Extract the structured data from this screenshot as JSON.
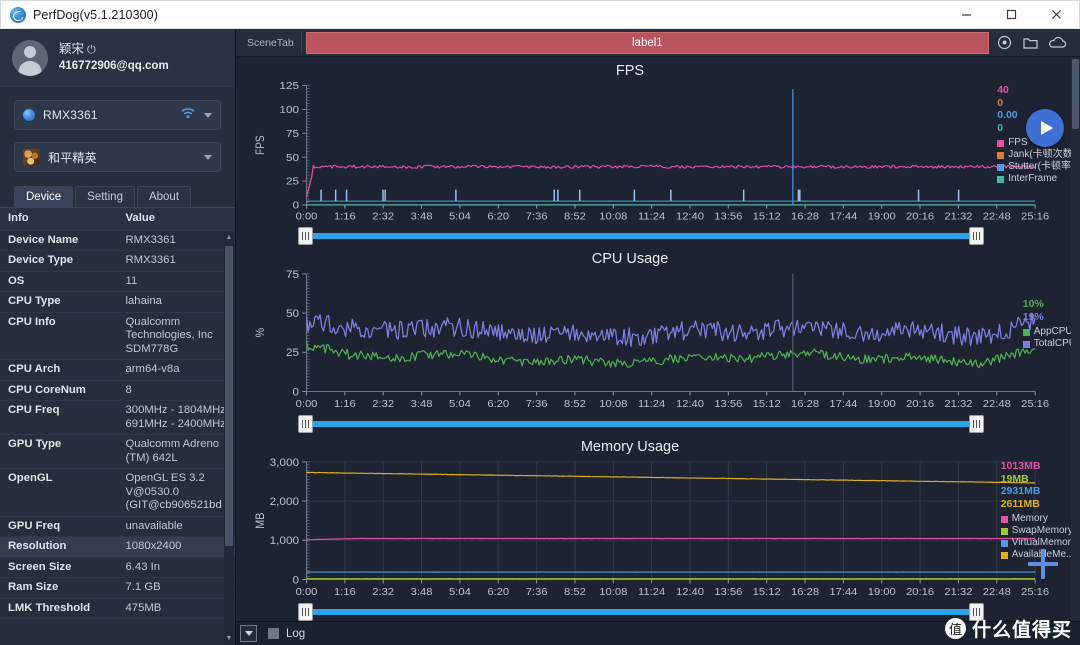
{
  "window": {
    "title": "PerfDog(v5.1.210300)",
    "minimize_label": "Minimize",
    "maximize_label": "Maximize",
    "close_label": "Close"
  },
  "sidebar": {
    "user": {
      "name": "颖宋",
      "power_glyph": "⏻",
      "email": "416772906@qq.com"
    },
    "device_select": {
      "value": "RMX3361"
    },
    "app_select": {
      "value": "和平精英"
    },
    "tabs": [
      {
        "label": "Device",
        "active": true
      },
      {
        "label": "Setting",
        "active": false
      },
      {
        "label": "About",
        "active": false
      }
    ],
    "table": {
      "headers": [
        "Info",
        "Value"
      ],
      "rows": [
        {
          "key": "Device Name",
          "value": "RMX3361",
          "highlight": false
        },
        {
          "key": "Device Type",
          "value": "RMX3361",
          "highlight": false
        },
        {
          "key": "OS",
          "value": "11",
          "highlight": false
        },
        {
          "key": "CPU Type",
          "value": "lahaina",
          "highlight": false
        },
        {
          "key": "CPU Info",
          "value": "Qualcomm Technologies, Inc SDM778G",
          "highlight": false
        },
        {
          "key": "CPU Arch",
          "value": "arm64-v8a",
          "highlight": false
        },
        {
          "key": "CPU CoreNum",
          "value": "8",
          "highlight": false
        },
        {
          "key": "CPU Freq",
          "value": "300MHz - 1804MHz 691MHz - 2400MHz",
          "highlight": false
        },
        {
          "key": "GPU Type",
          "value": "Qualcomm Adreno (TM) 642L",
          "highlight": false
        },
        {
          "key": "OpenGL",
          "value": "OpenGL ES 3.2 V@0530.0 (GIT@cb906521bd",
          "highlight": false
        },
        {
          "key": "GPU Freq",
          "value": "unavailable",
          "highlight": false
        },
        {
          "key": "Resolution",
          "value": "1080x2400",
          "highlight": true
        },
        {
          "key": "Screen Size",
          "value": "6.43 In",
          "highlight": false
        },
        {
          "key": "Ram Size",
          "value": "7.1 GB",
          "highlight": false
        },
        {
          "key": "LMK Threshold",
          "value": "475MB",
          "highlight": false
        }
      ]
    }
  },
  "scenebar": {
    "scene_tab_label": "SceneTab",
    "label_text": "label1",
    "icons": [
      "location-icon",
      "folder-icon",
      "cloud-icon"
    ]
  },
  "controls": {
    "play_label": "Play",
    "add_label": "Add",
    "log_label": "Log",
    "expand_label": "Expand"
  },
  "watermark": {
    "badge": "值",
    "text": "什么值得买"
  },
  "chart_data": [
    {
      "type": "line",
      "title": "FPS",
      "ylabel": "FPS",
      "xlabel": "",
      "ylim": [
        0,
        125
      ],
      "yticks": [
        0,
        25,
        50,
        75,
        100,
        125
      ],
      "ytick_labels": [
        "0",
        "25",
        "50",
        "75",
        "100",
        "125"
      ],
      "xtick_labels": [
        "0:00",
        "1:16",
        "2:32",
        "3:48",
        "5:04",
        "6:20",
        "7:36",
        "8:52",
        "10:08",
        "11:24",
        "12:40",
        "13:56",
        "15:12",
        "16:28",
        "17:44",
        "19:00",
        "20:16",
        "21:32",
        "22:48",
        "25:16"
      ],
      "grid": false,
      "legend_position": "right",
      "readouts": [
        {
          "value": "40",
          "color": "#e34ea8"
        },
        {
          "value": "0",
          "color": "#e07830"
        },
        {
          "value": "0.00",
          "color": "#4f9ae8"
        },
        {
          "value": "0",
          "color": "#3fb8a8"
        }
      ],
      "series": [
        {
          "name": "FPS",
          "color": "#e34ea8",
          "mean": 40,
          "noise": 1.6
        },
        {
          "name": "Jank(卡顿次数)",
          "color": "#e07830",
          "mean": 0,
          "noise": 0
        },
        {
          "name": "Stutter(卡顿率)",
          "color": "#4f9ae8",
          "mean": 0,
          "noise": 0
        },
        {
          "name": "InterFrame",
          "color": "#3fb8a8",
          "mean": 0,
          "noise": 0
        }
      ]
    },
    {
      "type": "line",
      "title": "CPU Usage",
      "ylabel": "%",
      "xlabel": "",
      "ylim": [
        0,
        75
      ],
      "yticks": [
        0,
        25,
        50,
        75
      ],
      "ytick_labels": [
        "0",
        "25",
        "50",
        "75"
      ],
      "xtick_labels": [
        "0:00",
        "1:16",
        "2:32",
        "3:48",
        "5:04",
        "6:20",
        "7:36",
        "8:52",
        "10:08",
        "11:24",
        "12:40",
        "13:56",
        "15:12",
        "16:28",
        "17:44",
        "19:00",
        "20:16",
        "21:32",
        "22:48",
        "25:16"
      ],
      "grid": false,
      "legend_position": "right",
      "readouts": [
        {
          "value": "10%",
          "color": "#4caf50"
        },
        {
          "value": "19%",
          "color": "#7b7fe0"
        }
      ],
      "series": [
        {
          "name": "AppCPU",
          "color": "#4caf50",
          "mean": 21,
          "noise": 3
        },
        {
          "name": "TotalCPU",
          "color": "#7b7fe0",
          "mean": 38,
          "noise": 6
        }
      ]
    },
    {
      "type": "line",
      "title": "Memory Usage",
      "ylabel": "MB",
      "xlabel": "",
      "ylim": [
        0,
        3000
      ],
      "yticks": [
        0,
        1000,
        2000,
        3000
      ],
      "ytick_labels": [
        "0",
        "1,000",
        "2,000",
        "3,000"
      ],
      "xtick_labels": [
        "0:00",
        "1:16",
        "2:32",
        "3:48",
        "5:04",
        "6:20",
        "7:36",
        "8:52",
        "10:08",
        "11:24",
        "12:40",
        "13:56",
        "15:12",
        "16:28",
        "17:44",
        "19:00",
        "20:16",
        "21:32",
        "22:48",
        "25:16"
      ],
      "grid": true,
      "legend_position": "right",
      "readouts": [
        {
          "value": "1013MB",
          "color": "#e34ea8"
        },
        {
          "value": "19MB",
          "color": "#9ccc3a"
        },
        {
          "value": "2931MB",
          "color": "#4f9ae8"
        },
        {
          "value": "2611MB",
          "color": "#e0b020"
        }
      ],
      "series": [
        {
          "name": "Memory",
          "color": "#e34ea8",
          "mean": 1013,
          "noise": 12
        },
        {
          "name": "SwapMemory",
          "color": "#9ccc3a",
          "mean": 19,
          "noise": 2
        },
        {
          "name": "VirtualMemory",
          "color": "#4f9ae8",
          "mean": 190,
          "noise": 3
        },
        {
          "name": "AvailableMe...",
          "color": "#e0b020",
          "mean": 2730,
          "noise": 18
        }
      ]
    }
  ]
}
